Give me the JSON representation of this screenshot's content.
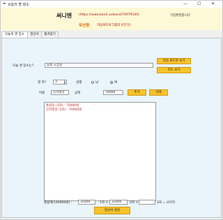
{
  "window": {
    "title": "오늘의 명 장소",
    "controls": {
      "minimize": "—",
      "maximize": "☐",
      "close": "✕"
    }
  },
  "header": {
    "brand": "써니텐",
    "url": "(https://www.band.us/band/70979140)",
    "greeting": "가입환영합니다",
    "edition": "무산편",
    "tagline": "자동화프로그램의 모든것!"
  },
  "tabs": [
    {
      "label": "오늘의 명 장소"
    },
    {
      "label": "정산서"
    },
    {
      "label": "즐겨찾기"
    }
  ],
  "form": {
    "location_label": "오늘 명 장소는?",
    "location_value": "동래 고궁남",
    "map_route_button": "다음 로드뷰 보기",
    "map_button": "지도 보기",
    "people_label": "명 자?",
    "people_value": "3",
    "gender_label": "성별",
    "gender_options": [
      {
        "label": "남",
        "selected": false
      },
      {
        "label": "여",
        "selected": true
      }
    ],
    "name_label": "이름",
    "name_value": "신자영양",
    "amount_label": "금액",
    "amount_value": "70000",
    "add_button": "추가",
    "delete_button": "삭제"
  },
  "entries": [
    {
      "text": "홍길동 (3차) - 70000원"
    },
    {
      "text": "신자영양 (3차) - 70000원"
    }
  ],
  "settlement": {
    "total_label": "총합계[140000원] -",
    "first_value": "35000",
    "first_label": "1차 +",
    "second_value": "32000",
    "second_label": "2차 +",
    "third_value": "",
    "third_label": "3차 = 나머지",
    "generate_button": "정산서 생성"
  }
}
